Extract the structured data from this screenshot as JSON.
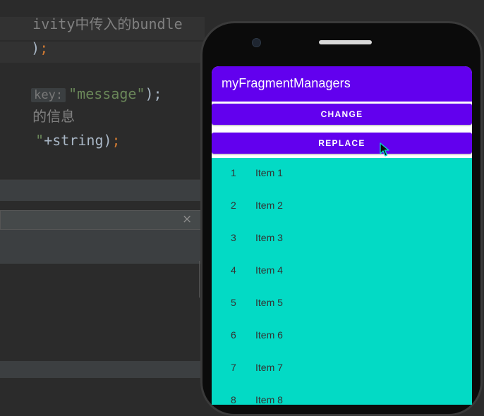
{
  "ide": {
    "code_lines": [
      {
        "comment": "ivity中传入的bundle"
      },
      {
        "text": ")",
        "tail": ";"
      },
      {
        "hint": "key:",
        "string": "\"message\"",
        "tail": ");"
      },
      {
        "comment": "的信息"
      },
      {
        "string": "\"",
        "text": "+string)",
        "tail": ";"
      }
    ],
    "find_close": "×"
  },
  "phone": {
    "app_title": "myFragmentManagers",
    "buttons": {
      "change": "CHANGE",
      "replace": "REPLACE"
    },
    "list": [
      {
        "num": "1",
        "label": "Item 1"
      },
      {
        "num": "2",
        "label": "Item 2"
      },
      {
        "num": "3",
        "label": "Item 3"
      },
      {
        "num": "4",
        "label": "Item 4"
      },
      {
        "num": "5",
        "label": "Item 5"
      },
      {
        "num": "6",
        "label": "Item 6"
      },
      {
        "num": "7",
        "label": "Item 7"
      },
      {
        "num": "8",
        "label": "Item 8"
      }
    ]
  },
  "colors": {
    "primary": "#6200ee",
    "accent": "#03dac5",
    "ide_bg": "#2b2b2b"
  },
  "icons": {
    "cursor": "mouse-pointer-icon",
    "close": "close-icon"
  }
}
